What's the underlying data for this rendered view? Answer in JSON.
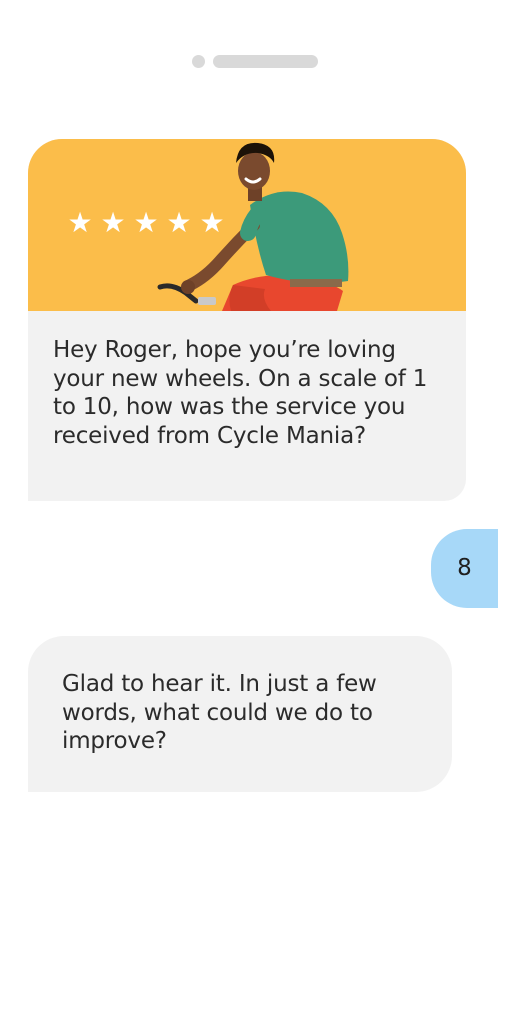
{
  "status_indicator": {
    "camera_dot": "camera-dot",
    "speaker_bar": "speaker-bar"
  },
  "messages": {
    "card": {
      "rating_stars": 5,
      "rating_max": 5,
      "text": "Hey Roger, hope you’re loving your new wheels. On a scale of 1 to 10, how was the service you received from Cycle Mania?",
      "hero_background": "#fbbd4a"
    },
    "reply": {
      "text": "8",
      "color": "#a7d8f8"
    },
    "followup": {
      "text": "Glad to hear it. In just a few words, what could we do to improve?"
    }
  },
  "icons": {
    "star": "★"
  }
}
